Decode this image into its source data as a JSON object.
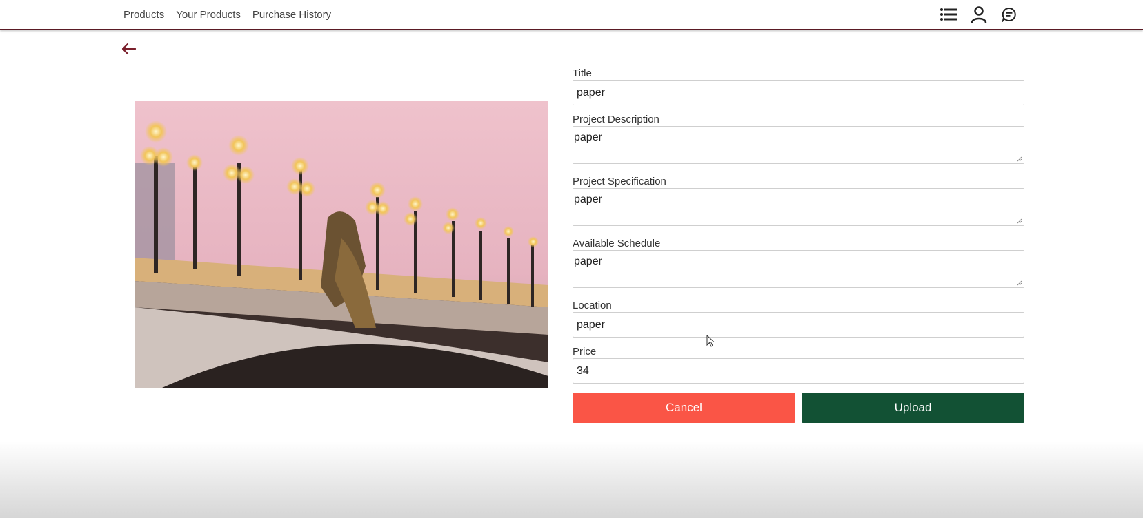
{
  "nav": {
    "links": [
      "Products",
      "Your Products",
      "Purchase History"
    ],
    "icons": [
      "list-icon",
      "user-icon",
      "chat-icon"
    ]
  },
  "colors": {
    "accent": "#5a1a24",
    "cancel": "#fa5546",
    "upload": "#125134"
  },
  "form": {
    "title": {
      "label": "Title",
      "value": "paper"
    },
    "description": {
      "label": "Project Description",
      "value": "paper"
    },
    "specification": {
      "label": "Project Specification",
      "value": "paper"
    },
    "schedule": {
      "label": "Available Schedule",
      "value": "paper"
    },
    "location": {
      "label": "Location",
      "value": "paper"
    },
    "price": {
      "label": "Price",
      "value": "34"
    }
  },
  "buttons": {
    "cancel": "Cancel",
    "upload": "Upload"
  }
}
